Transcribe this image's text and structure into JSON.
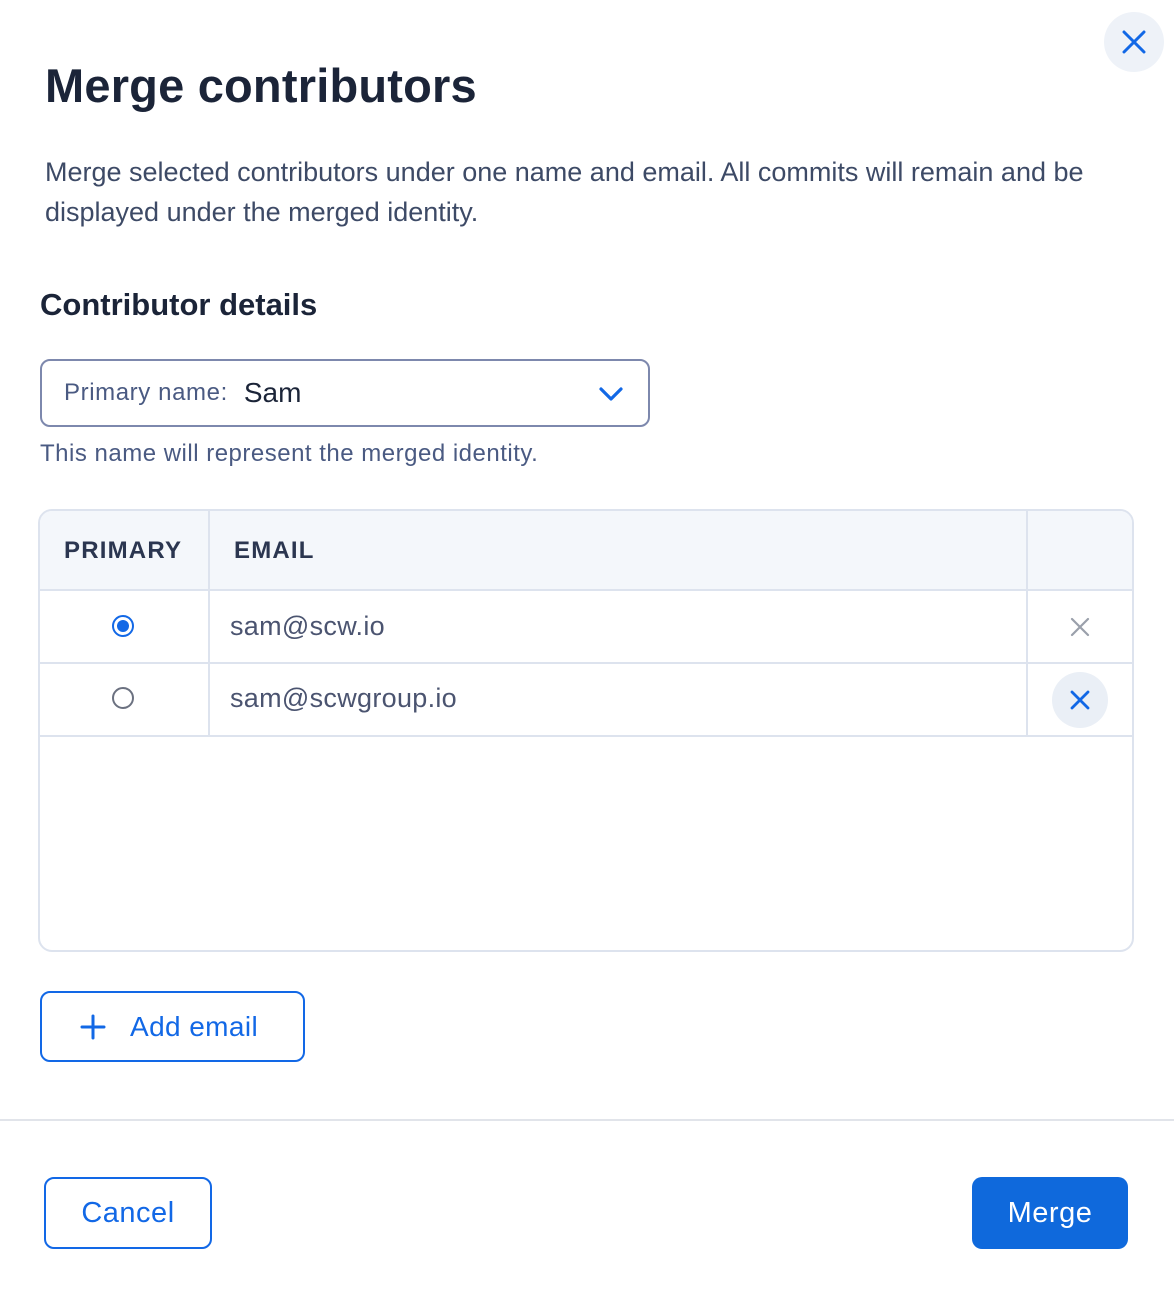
{
  "dialog": {
    "title": "Merge contributors",
    "description": "Merge selected contributors under one name and email. All commits will remain and be displayed under the merged identity.",
    "close_icon": "close-icon"
  },
  "details": {
    "section_title": "Contributor details",
    "primary_name": {
      "label": "Primary name:",
      "value": "Sam",
      "icon": "chevron-down-icon"
    },
    "helper": "This name will represent the merged identity."
  },
  "table": {
    "headers": {
      "primary": "PRIMARY",
      "email": "EMAIL",
      "actions": ""
    },
    "rows": [
      {
        "primary": true,
        "email": "sam@scw.io"
      },
      {
        "primary": false,
        "email": "sam@scwgroup.io"
      }
    ]
  },
  "actions": {
    "add_email": "Add email",
    "cancel": "Cancel",
    "merge": "Merge"
  },
  "colors": {
    "accent": "#1268e6",
    "title": "#1b2438",
    "muted": "#4a5a82",
    "border": "#dde3ee"
  }
}
